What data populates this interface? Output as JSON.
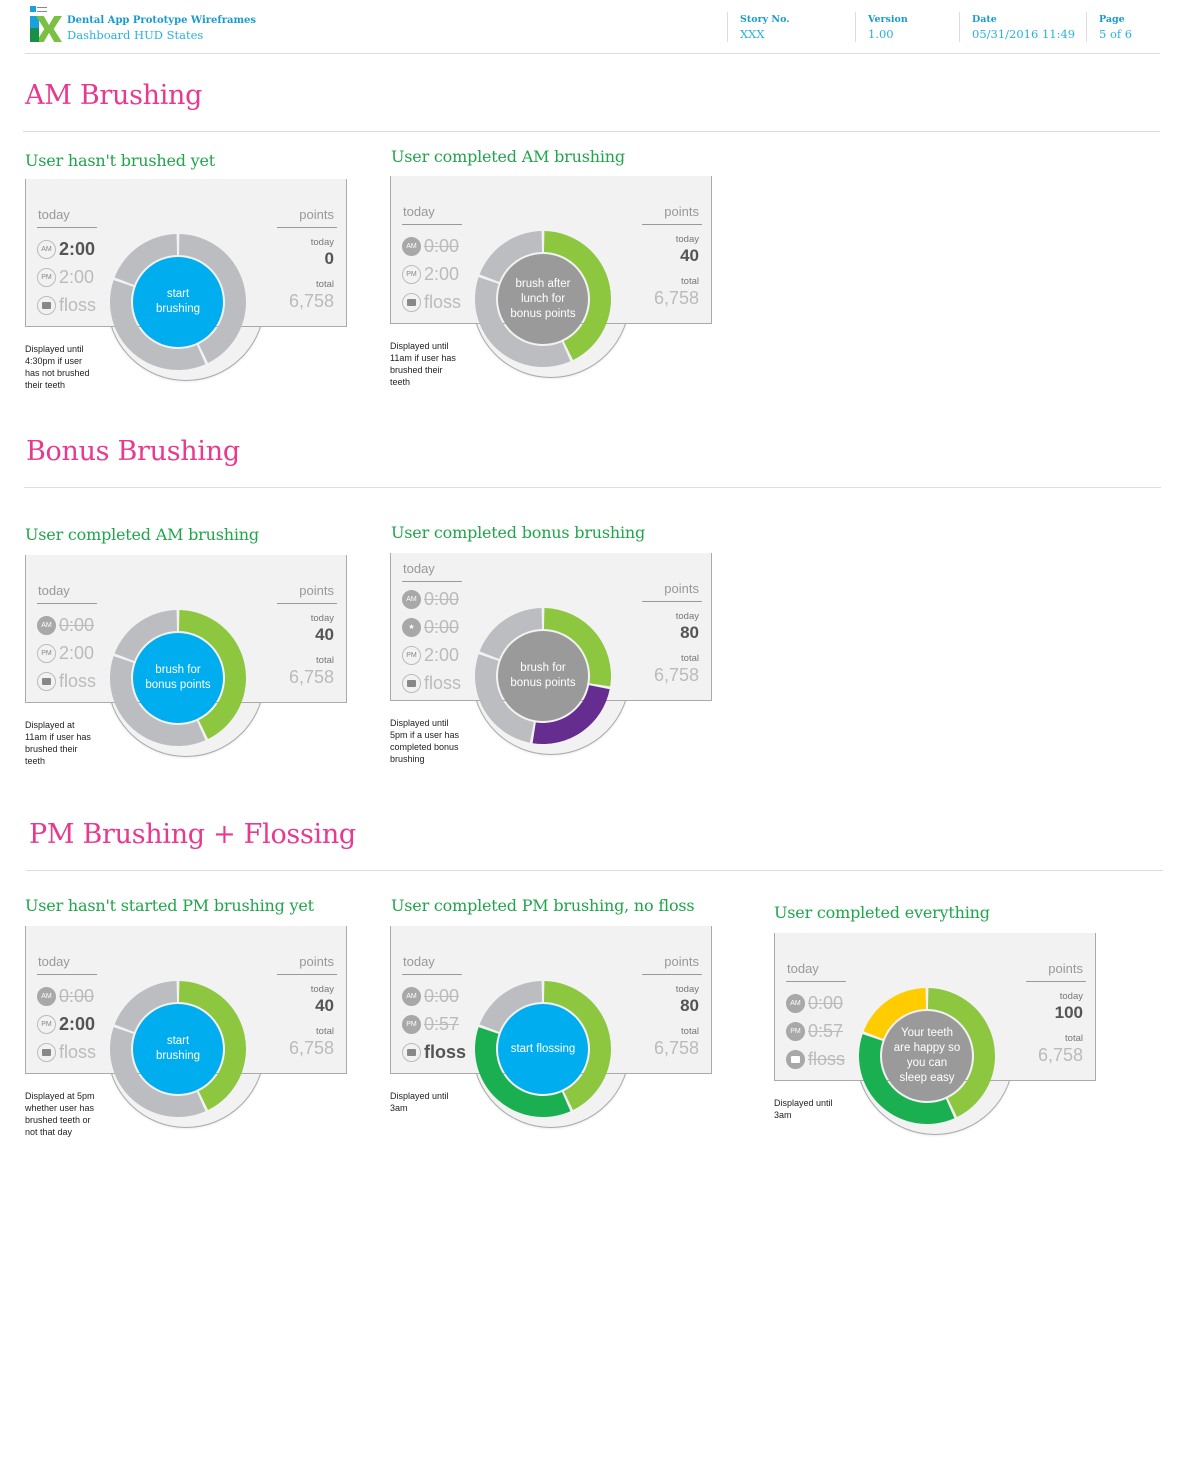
{
  "header": {
    "project_title": "Dental App Prototype Wireframes",
    "page_subtitle": "Dashboard HUD States",
    "meta": [
      {
        "key": "Story No.",
        "value": "XXX"
      },
      {
        "key": "Version",
        "value": "1.00"
      },
      {
        "key": "Date",
        "value": "05/31/2016 11:49"
      },
      {
        "key": "Page",
        "value": "5 of 6"
      }
    ],
    "logo": "ix-logo"
  },
  "colors": {
    "section_heading": "#e8398f",
    "state_heading": "#1fa54a",
    "header_text": "#1a9bd0",
    "cta_blue": "#00aeef",
    "idle_gray": "#9a9a9a",
    "ring_empty": "#bcbdc0",
    "ring_am": "#8dc63f",
    "ring_pm": "#1aaf50",
    "ring_bonus": "#662d91",
    "ring_floss": "#ffcc00"
  },
  "labels": {
    "today": "today",
    "points": "points",
    "points_today": "today",
    "points_total": "total",
    "badge_am": "AM",
    "badge_pm": "PM",
    "badge_bonus": "★"
  },
  "sections": [
    {
      "title": "AM Brushing",
      "states": [
        {
          "heading": "User hasn't brushed yet",
          "rows": [
            {
              "badge": "AM",
              "icon": "am-badge-icon",
              "done": false,
              "value": "2:00",
              "style": "active"
            },
            {
              "badge": "PM",
              "icon": "pm-badge-icon",
              "done": false,
              "value": "2:00",
              "style": "muted"
            },
            {
              "badge": "",
              "icon": "floss-icon",
              "done": false,
              "value": "floss",
              "style": "muted"
            }
          ],
          "points_today": "0",
          "points_total": "6,758",
          "center_text": "start\nbrushing",
          "center_color": "cta",
          "ring": [
            {
              "segment": "am",
              "fill": "empty"
            },
            {
              "segment": "pm",
              "fill": "empty"
            },
            {
              "segment": "floss",
              "fill": "empty"
            }
          ],
          "note": "Displayed until\n4:30pm if user\nhas not brushed\ntheir teeth"
        },
        {
          "heading": "User completed AM brushing",
          "rows": [
            {
              "badge": "AM",
              "icon": "am-badge-icon",
              "done": true,
              "value": "0:00",
              "style": "strike"
            },
            {
              "badge": "PM",
              "icon": "pm-badge-icon",
              "done": false,
              "value": "2:00",
              "style": "muted"
            },
            {
              "badge": "",
              "icon": "floss-icon",
              "done": false,
              "value": "floss",
              "style": "muted"
            }
          ],
          "points_today": "40",
          "points_total": "6,758",
          "center_text": "brush after\nlunch for\nbonus points",
          "center_color": "idle",
          "ring": [
            {
              "segment": "am",
              "fill": "am"
            },
            {
              "segment": "pm",
              "fill": "empty"
            },
            {
              "segment": "floss",
              "fill": "empty"
            }
          ],
          "note": "Displayed until\n11am if user has\nbrushed their\nteeth"
        }
      ]
    },
    {
      "title": "Bonus Brushing",
      "states": [
        {
          "heading": "User completed AM brushing",
          "rows": [
            {
              "badge": "AM",
              "icon": "am-badge-icon",
              "done": true,
              "value": "0:00",
              "style": "strike"
            },
            {
              "badge": "PM",
              "icon": "pm-badge-icon",
              "done": false,
              "value": "2:00",
              "style": "muted"
            },
            {
              "badge": "",
              "icon": "floss-icon",
              "done": false,
              "value": "floss",
              "style": "muted"
            }
          ],
          "points_today": "40",
          "points_total": "6,758",
          "center_text": "brush for\nbonus points",
          "center_color": "cta",
          "ring": [
            {
              "segment": "am",
              "fill": "am"
            },
            {
              "segment": "pm",
              "fill": "empty"
            },
            {
              "segment": "floss",
              "fill": "empty"
            }
          ],
          "note": "Displayed at\n11am if user has\nbrushed their\nteeth"
        },
        {
          "heading": "User completed bonus brushing",
          "rows": [
            {
              "badge": "AM",
              "icon": "am-badge-icon",
              "done": true,
              "value": "0:00",
              "style": "strike"
            },
            {
              "badge": "★",
              "icon": "bonus-star-icon",
              "done": true,
              "value": "0:00",
              "style": "strike"
            },
            {
              "badge": "PM",
              "icon": "pm-badge-icon",
              "done": false,
              "value": "2:00",
              "style": "muted"
            },
            {
              "badge": "",
              "icon": "floss-icon",
              "done": false,
              "value": "floss",
              "style": "muted"
            }
          ],
          "points_today": "80",
          "points_total": "6,758",
          "center_text": "brush for\nbonus points",
          "center_color": "idle",
          "ring": [
            {
              "segment": "am",
              "fill": "am"
            },
            {
              "segment": "bonus",
              "fill": "bonus"
            },
            {
              "segment": "pm",
              "fill": "empty"
            },
            {
              "segment": "floss",
              "fill": "empty"
            }
          ],
          "note": "Displayed until\n5pm if a user has\ncompleted bonus\nbrushing"
        }
      ]
    },
    {
      "title": "PM Brushing + Flossing",
      "states": [
        {
          "heading": "User hasn't started PM brushing yet",
          "rows": [
            {
              "badge": "AM",
              "icon": "am-badge-icon",
              "done": true,
              "value": "0:00",
              "style": "strike"
            },
            {
              "badge": "PM",
              "icon": "pm-badge-icon",
              "done": false,
              "value": "2:00",
              "style": "active"
            },
            {
              "badge": "",
              "icon": "floss-icon",
              "done": false,
              "value": "floss",
              "style": "muted"
            }
          ],
          "points_today": "40",
          "points_total": "6,758",
          "center_text": "start\nbrushing",
          "center_color": "cta",
          "ring": [
            {
              "segment": "am",
              "fill": "am"
            },
            {
              "segment": "pm",
              "fill": "empty"
            },
            {
              "segment": "floss",
              "fill": "empty"
            }
          ],
          "note": "Displayed at 5pm\nwhether user has\nbrushed teeth or\nnot that day"
        },
        {
          "heading": "User completed PM brushing, no floss",
          "rows": [
            {
              "badge": "AM",
              "icon": "am-badge-icon",
              "done": true,
              "value": "0:00",
              "style": "strike"
            },
            {
              "badge": "PM",
              "icon": "pm-badge-icon",
              "done": true,
              "value": "0:57",
              "style": "strike"
            },
            {
              "badge": "",
              "icon": "floss-icon",
              "done": false,
              "value": "floss",
              "style": "active"
            }
          ],
          "points_today": "80",
          "points_total": "6,758",
          "center_text": "start flossing",
          "center_color": "cta",
          "ring": [
            {
              "segment": "am",
              "fill": "am"
            },
            {
              "segment": "pm",
              "fill": "pm"
            },
            {
              "segment": "floss",
              "fill": "empty"
            }
          ],
          "note": "Displayed until\n3am"
        },
        {
          "heading": "User completed everything",
          "rows": [
            {
              "badge": "AM",
              "icon": "am-badge-icon",
              "done": true,
              "value": "0:00",
              "style": "strike"
            },
            {
              "badge": "PM",
              "icon": "pm-badge-icon",
              "done": true,
              "value": "0:57",
              "style": "strike"
            },
            {
              "badge": "",
              "icon": "floss-icon",
              "done": true,
              "value": "floss",
              "style": "strike"
            }
          ],
          "points_today": "100",
          "points_total": "6,758",
          "center_text": "Your teeth\nare happy so\nyou can\nsleep easy",
          "center_color": "idle",
          "ring": [
            {
              "segment": "am",
              "fill": "am"
            },
            {
              "segment": "pm",
              "fill": "pm"
            },
            {
              "segment": "floss",
              "fill": "floss"
            }
          ],
          "note": "Displayed until\n3am"
        }
      ]
    }
  ]
}
